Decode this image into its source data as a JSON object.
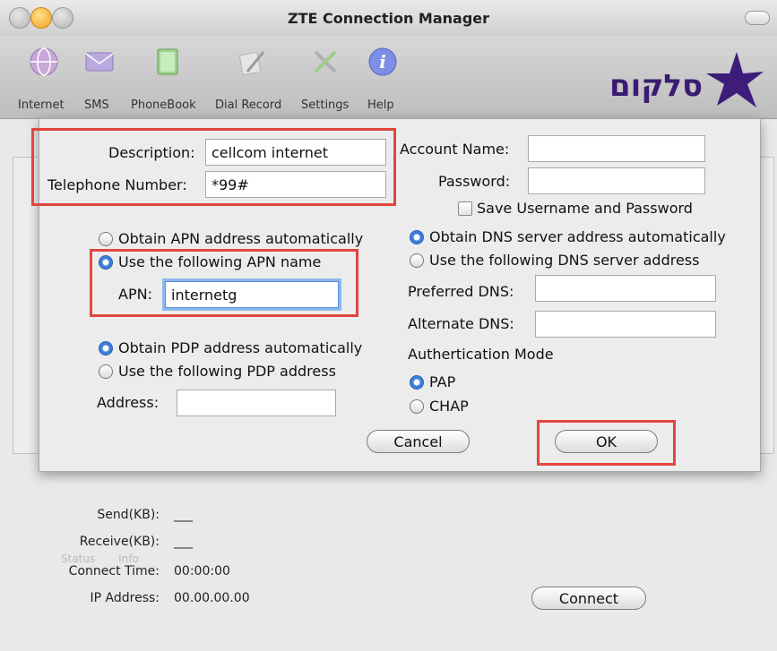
{
  "window": {
    "title": "ZTE Connection Manager"
  },
  "toolbar": {
    "items": [
      {
        "label": "Internet",
        "icon": "globe-icon"
      },
      {
        "label": "SMS",
        "icon": "envelope-icon"
      },
      {
        "label": "PhoneBook",
        "icon": "phonebook-icon"
      },
      {
        "label": "Dial Record",
        "icon": "dial-record-icon"
      },
      {
        "label": "Settings",
        "icon": "settings-tools-icon"
      },
      {
        "label": "Help",
        "icon": "info-icon"
      }
    ],
    "logo_text": "סלקום"
  },
  "dialog": {
    "description_label": "Description:",
    "description_value": "cellcom internet",
    "telephone_label": "Telephone Number:",
    "telephone_value": "*99#",
    "account_label": "Account Name:",
    "account_value": "",
    "password_label": "Password:",
    "password_value": "",
    "save_label": "Save Username and Password",
    "apn_auto_label": "Obtain APN address automatically",
    "apn_manual_label": "Use the following APN name",
    "apn_label": "APN:",
    "apn_value": "internetg",
    "dns_auto_label": "Obtain DNS server address automatically",
    "dns_manual_label": "Use the following DNS server address",
    "preferred_dns_label": "Preferred DNS:",
    "alternate_dns_label": "Alternate DNS:",
    "pdp_auto_label": "Obtain PDP address automatically",
    "pdp_manual_label": "Use the following PDP address",
    "address_label": "Address:",
    "auth_label": "Authertication Mode",
    "pap_label": "PAP",
    "chap_label": "CHAP",
    "cancel_label": "Cancel",
    "ok_label": "OK"
  },
  "status": {
    "tab_status": "Status",
    "tab_info": "Info",
    "send_label": "Send(KB):",
    "send_value": "___",
    "receive_label": "Receive(KB):",
    "receive_value": "___",
    "connect_time_label": "Connect Time:",
    "connect_time_value": "00:00:00",
    "ip_label": "IP Address:",
    "ip_value": "00.00.00.00",
    "connect_label": "Connect"
  },
  "colors": {
    "highlight_box": "#e2463f",
    "radio_selected": "#3b7fd9",
    "logo": "#3a1c72"
  }
}
